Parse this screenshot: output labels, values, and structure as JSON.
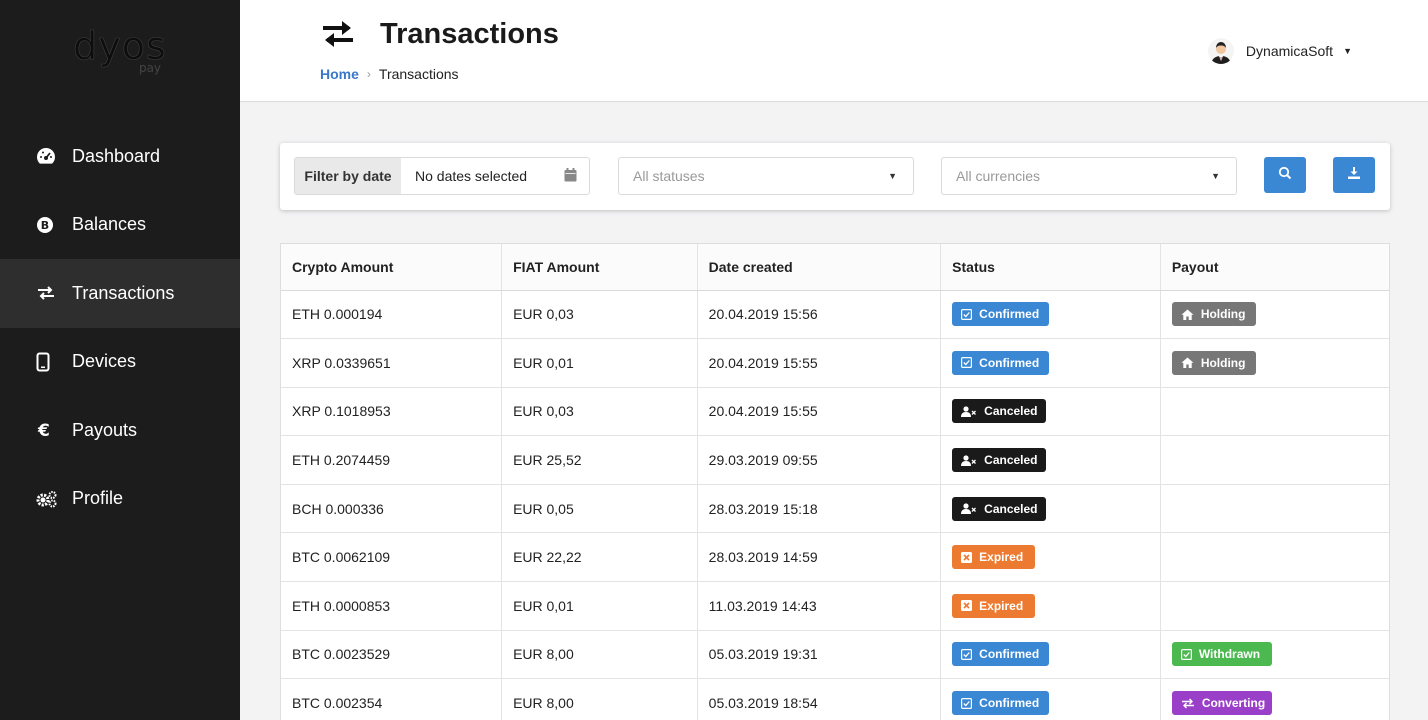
{
  "logo": {
    "main": "dyos",
    "sub": "pay"
  },
  "sidebar": {
    "items": [
      {
        "label": "Dashboard",
        "icon": "dashboard-icon"
      },
      {
        "label": "Balances",
        "icon": "bitcoin-icon"
      },
      {
        "label": "Transactions",
        "icon": "exchange-icon",
        "active": true
      },
      {
        "label": "Devices",
        "icon": "mobile-icon"
      },
      {
        "label": "Payouts",
        "icon": "euro-icon"
      },
      {
        "label": "Profile",
        "icon": "cogs-icon"
      }
    ]
  },
  "header": {
    "title": "Transactions",
    "breadcrumb": {
      "home": "Home",
      "separator": "›",
      "current": "Transactions"
    },
    "user": {
      "name": "DynamicaSoft"
    }
  },
  "filters": {
    "date_label": "Filter by date",
    "date_value": "No dates selected",
    "status_placeholder": "All statuses",
    "currency_placeholder": "All currencies"
  },
  "table": {
    "headers": [
      "Crypto Amount",
      "FIAT Amount",
      "Date created",
      "Status",
      "Payout"
    ],
    "rows": [
      {
        "crypto": "ETH 0.000194",
        "fiat": "EUR 0,03",
        "date": "20.04.2019 15:56",
        "status": "Confirmed",
        "payout": "Holding"
      },
      {
        "crypto": "XRP 0.0339651",
        "fiat": "EUR 0,01",
        "date": "20.04.2019 15:55",
        "status": "Confirmed",
        "payout": "Holding"
      },
      {
        "crypto": "XRP 0.1018953",
        "fiat": "EUR 0,03",
        "date": "20.04.2019 15:55",
        "status": "Canceled",
        "payout": ""
      },
      {
        "crypto": "ETH 0.2074459",
        "fiat": "EUR 25,52",
        "date": "29.03.2019 09:55",
        "status": "Canceled",
        "payout": ""
      },
      {
        "crypto": "BCH 0.000336",
        "fiat": "EUR 0,05",
        "date": "28.03.2019 15:18",
        "status": "Canceled",
        "payout": ""
      },
      {
        "crypto": "BTC 0.0062109",
        "fiat": "EUR 22,22",
        "date": "28.03.2019 14:59",
        "status": "Expired",
        "payout": ""
      },
      {
        "crypto": "ETH 0.0000853",
        "fiat": "EUR 0,01",
        "date": "11.03.2019 14:43",
        "status": "Expired",
        "payout": ""
      },
      {
        "crypto": "BTC 0.0023529",
        "fiat": "EUR 8,00",
        "date": "05.03.2019 19:31",
        "status": "Confirmed",
        "payout": "Withdrawn"
      },
      {
        "crypto": "BTC 0.002354",
        "fiat": "EUR 8,00",
        "date": "05.03.2019 18:54",
        "status": "Confirmed",
        "payout": "Converting"
      }
    ]
  },
  "colors": {
    "sidebar_bg": "#1c1c1c",
    "accent_blue": "#3a88d4",
    "confirmed": "#3a88d4",
    "canceled": "#1a1a1a",
    "expired": "#ec7a30",
    "holding": "#777777",
    "withdrawn": "#4bb94f",
    "converting": "#9a3fc7"
  }
}
